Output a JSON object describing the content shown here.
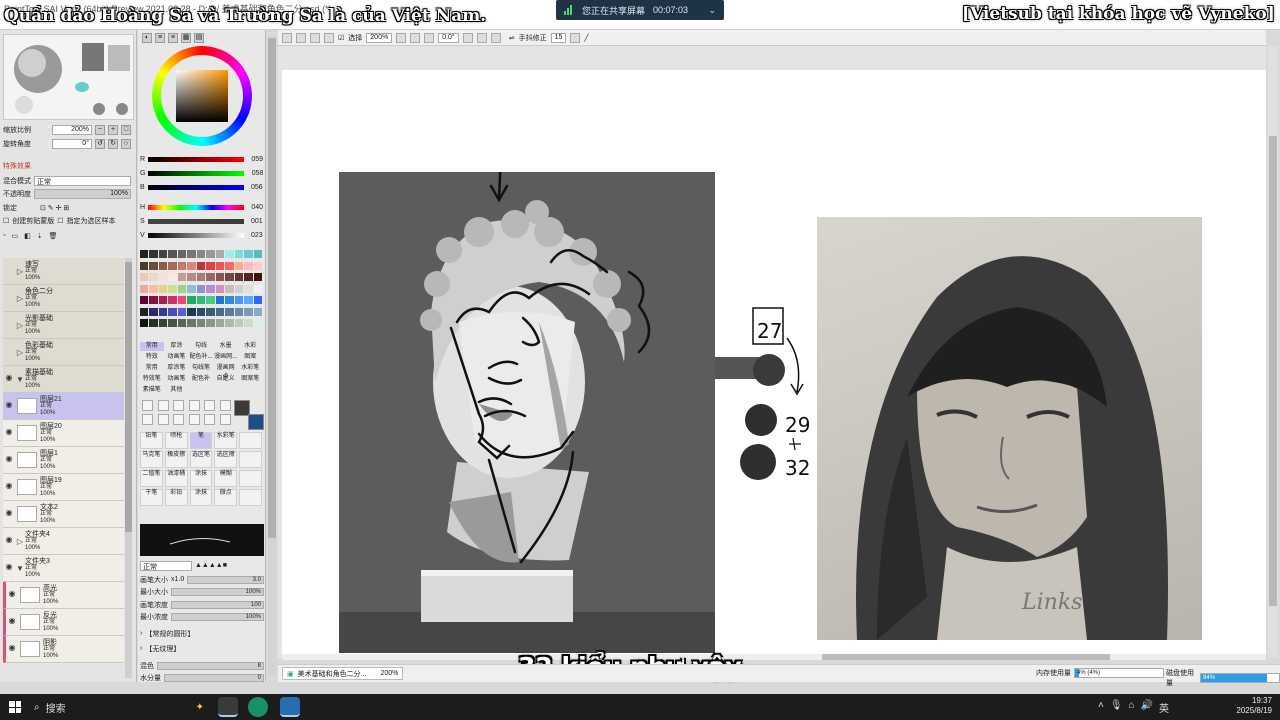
{
  "window": {
    "title": "PaintTool SAI Ver.2 (64bit) Preview.2021.03.28 - D:/D/ 美术基础和角色二分.psd (*)",
    "overlay_top_left": "Quần đảo Hoàng Sa và Trường Sa là của Việt Nam.",
    "overlay_top_right": "[Vietsub tại khóa học vẽ Vyneko]",
    "share_label": "您正在共享屏幕",
    "share_time": "00:07:03"
  },
  "left_panel": {
    "zoom_label": "缩放比例",
    "zoom_value": "200%",
    "angle_label": "旋转角度",
    "angle_value": "0°",
    "effects_label": "特殊效果",
    "blend_label": "混合模式",
    "blend_value": "正常",
    "opacity_label": "不透明度",
    "opacity_value": "100%",
    "lock_label": "锁定",
    "clip_label": "创建剪贴蒙版",
    "ref_label": "指定为选区样本"
  },
  "layers": [
    {
      "name": "速写",
      "mode": "正常",
      "opacity": "100%",
      "folder": true,
      "sub": false,
      "selected": false,
      "pink": false
    },
    {
      "name": "角色二分",
      "mode": "正常",
      "opacity": "100%",
      "folder": true,
      "sub": false,
      "selected": false,
      "pink": false
    },
    {
      "name": "光影基础",
      "mode": "正常",
      "opacity": "100%",
      "folder": true,
      "sub": false,
      "selected": false,
      "pink": false
    },
    {
      "name": "色彩基础",
      "mode": "正常",
      "opacity": "100%",
      "folder": true,
      "sub": false,
      "selected": false,
      "pink": false
    },
    {
      "name": "素描基础",
      "mode": "正常",
      "opacity": "100%",
      "folder": true,
      "sub": false,
      "selected": false,
      "pink": false
    },
    {
      "name": "图层21",
      "mode": "正常",
      "opacity": "100%",
      "folder": false,
      "sub": true,
      "selected": true,
      "pink": false
    },
    {
      "name": "图层20",
      "mode": "正常",
      "opacity": "100%",
      "folder": false,
      "sub": true,
      "selected": false,
      "pink": false
    },
    {
      "name": "图层1",
      "mode": "正常",
      "opacity": "100%",
      "folder": false,
      "sub": true,
      "selected": false,
      "pink": false
    },
    {
      "name": "图层19",
      "mode": "正常",
      "opacity": "100%",
      "folder": false,
      "sub": true,
      "selected": false,
      "pink": false
    },
    {
      "name": "文本2",
      "mode": "正常",
      "opacity": "100%",
      "folder": false,
      "sub": true,
      "selected": false,
      "pink": false
    },
    {
      "name": "文件夹4",
      "mode": "正常",
      "opacity": "100%",
      "folder": true,
      "sub": true,
      "selected": false,
      "pink": false
    },
    {
      "name": "文件夹3",
      "mode": "正常",
      "opacity": "100%",
      "folder": true,
      "sub": true,
      "selected": false,
      "pink": false
    },
    {
      "name": "高光",
      "mode": "正常",
      "opacity": "100%",
      "folder": false,
      "sub": true,
      "selected": false,
      "pink": true
    },
    {
      "name": "反光",
      "mode": "正常",
      "opacity": "100%",
      "folder": false,
      "sub": true,
      "selected": false,
      "pink": true
    },
    {
      "name": "阴影",
      "mode": "正常",
      "opacity": "100%",
      "folder": false,
      "sub": true,
      "selected": false,
      "pink": true
    }
  ],
  "color_sliders": [
    {
      "label": "R",
      "value": "059",
      "gradient": "linear-gradient(to right,#000,#ff0000)"
    },
    {
      "label": "G",
      "value": "058",
      "gradient": "linear-gradient(to right,#000,#00ff00)"
    },
    {
      "label": "B",
      "value": "056",
      "gradient": "linear-gradient(to right,#000,#0000ff)"
    },
    {
      "label": "H",
      "value": "040",
      "gradient": "linear-gradient(to right,#f00,#ff0,#0f0,#0ff,#00f,#f0f,#f00)"
    },
    {
      "label": "S",
      "value": "001",
      "gradient": "linear-gradient(to right,#444,#3b3a38)"
    },
    {
      "label": "V",
      "value": "023",
      "gradient": "linear-gradient(to right,#000,#fff)"
    }
  ],
  "tool_tabs": [
    "常用",
    "厚涂",
    "勾线",
    "水墨",
    "水彩",
    "特效",
    "动画笔",
    "配色补...",
    "漫画网...",
    "图案",
    "常用",
    "厚涂笔",
    "勾线笔",
    "漫画网点",
    "水彩笔",
    "特效笔",
    "动画笔",
    "配色补",
    "自定义",
    "图案笔",
    "素描笔",
    "其他"
  ],
  "brushes": [
    "铅笔",
    "喷枪",
    "笔",
    "水彩笔",
    "",
    "马克笔",
    "橡皮擦",
    "选区笔",
    "选区擦",
    "",
    "二值笔",
    "油漆桶",
    "涂抹",
    "模糊",
    "",
    "干笔",
    "彩铅",
    "涂抹",
    "微点",
    ""
  ],
  "brush_options": {
    "mode": "正常",
    "size_label": "画笔大小",
    "size_mult": "x1.0",
    "size_value": "3.0",
    "min_size_label": "最小大小",
    "min_size_value": "100%",
    "density_label": "画笔浓度",
    "density_value": "100",
    "min_density_label": "最小浓度",
    "min_density_value": "100%",
    "shape_label": "【常规的圆形】",
    "texture_label": "【无纹理】",
    "blend_label": "混色",
    "blend_value": "8",
    "water_label": "水分量",
    "water_value": "0"
  },
  "canvas_toolbar": {
    "select_label": "选择",
    "zoom": "200%",
    "angle": "0.0°",
    "stabilizer_label": "手抖修正",
    "stabilizer_value": "15"
  },
  "annotations": {
    "box_number": "27",
    "num1": "29",
    "num2": "32",
    "signature": "Links"
  },
  "subtitle": "32 kiểu như vậy,",
  "statusbar": {
    "doc_tab": "美术基础和角色二分...",
    "doc_zoom": "200%",
    "mem_label": "内存使用量",
    "mem_value": "4% (4%)",
    "mem_percent": 4,
    "disk_label": "磁盘使用量",
    "disk_value": "84%",
    "disk_percent": 84
  },
  "taskbar": {
    "search": "搜索",
    "time": "19:37",
    "date": "2025/8/19",
    "ime": "英"
  }
}
